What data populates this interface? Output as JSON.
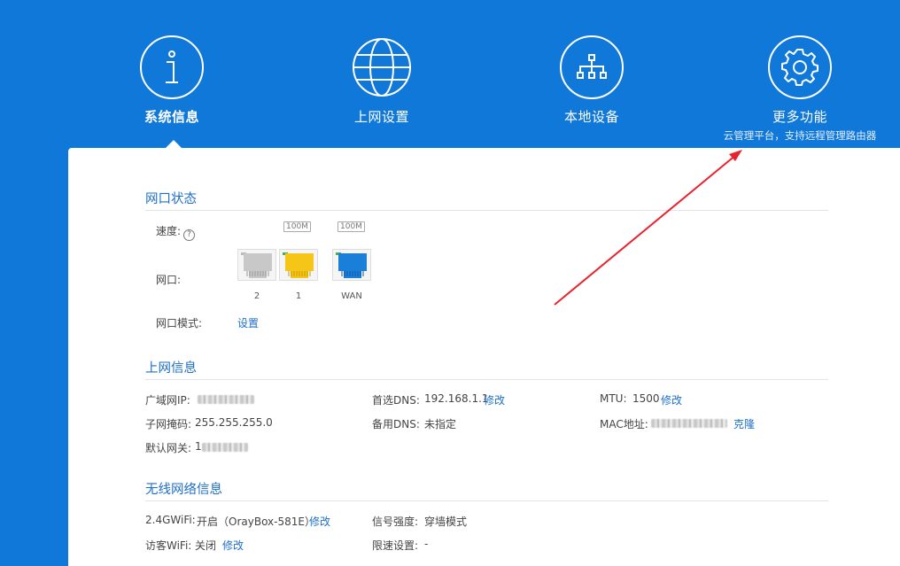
{
  "nav": {
    "items": [
      {
        "label": "系统信息",
        "icon": "info-icon"
      },
      {
        "label": "上网设置",
        "icon": "globe-icon"
      },
      {
        "label": "本地设备",
        "icon": "network-tree-icon"
      },
      {
        "label": "更多功能",
        "icon": "gear-icon",
        "sub": "云管理平台，支持远程管理路由器"
      }
    ]
  },
  "port_status": {
    "title": "网口状态",
    "speed_label": "速度:",
    "help": "?",
    "ports_label": "网口:",
    "mode_label": "网口模式:",
    "mode_link": "设置",
    "ports": [
      {
        "number": "2",
        "speed": "",
        "color": "#c8c8c8"
      },
      {
        "number": "1",
        "speed": "100M",
        "color": "#f5c518"
      },
      {
        "number": "WAN",
        "speed": "100M",
        "color": "#1a7fd8"
      }
    ]
  },
  "internet_info": {
    "title": "上网信息",
    "wan_ip_label": "广域网IP:",
    "dns1_label": "首选DNS:",
    "dns1_value": "192.168.1.1",
    "dns1_link": "修改",
    "mtu_label": "MTU:",
    "mtu_value": "1500",
    "mtu_link": "修改",
    "subnet_label": "子网掩码:",
    "subnet_value": "255.255.255.0",
    "dns2_label": "备用DNS:",
    "dns2_value": "未指定",
    "mac_label": "MAC地址:",
    "mac_link": "克隆",
    "gateway_label": "默认网关:",
    "gateway_prefix": "1"
  },
  "wireless_info": {
    "title": "无线网络信息",
    "wifi24_label": "2.4GWiFi:",
    "wifi24_value": "开启（OrayBox-581E）",
    "wifi24_link": "修改",
    "signal_label": "信号强度:",
    "signal_value": "穿墙模式",
    "guest_label": "访客WiFi:",
    "guest_value": "关闭",
    "guest_link": "修改",
    "limit_label": "限速设置:",
    "limit_value": "-"
  },
  "colors": {
    "header_bg": "#0f78d9",
    "accent": "#1e6fc8",
    "arrow": "#e8232e"
  }
}
